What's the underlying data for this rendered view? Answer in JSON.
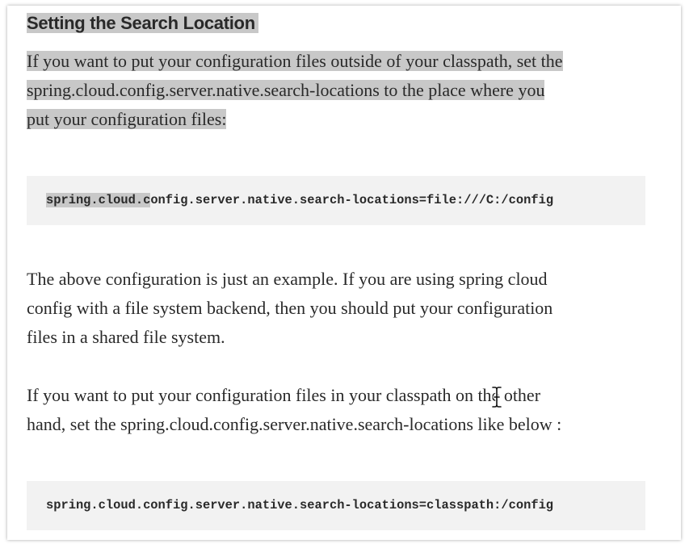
{
  "article": {
    "heading": "Setting the Search Location",
    "intro": {
      "line1": "If you want to put your configuration files outside of your classpath, set the",
      "line2": "spring.cloud.config.server.native.search-locations to the place where you",
      "line3": "put your configuration files:"
    },
    "code1": {
      "selected_part": "spring.cloud.c",
      "rest": "onfig.server.native.search-locations=file:///C:/config"
    },
    "para2": {
      "line1": "The above configuration is just an example. If you are using spring cloud",
      "line2": "config with a file system backend, then you should put your configuration",
      "line3": "files in a shared file system."
    },
    "para3": {
      "line1": "If you want to put your configuration files in your classpath on the other",
      "line2": "hand, set the spring.cloud.config.server.native.search-locations like below :"
    },
    "code2": {
      "text": "spring.cloud.config.server.native.search-locations=classpath:/config"
    }
  },
  "colors": {
    "selection": "#c8c8c8",
    "code_background": "#f2f2f2",
    "text": "#292929"
  },
  "icons": {
    "cursor": "text-cursor-icon"
  }
}
